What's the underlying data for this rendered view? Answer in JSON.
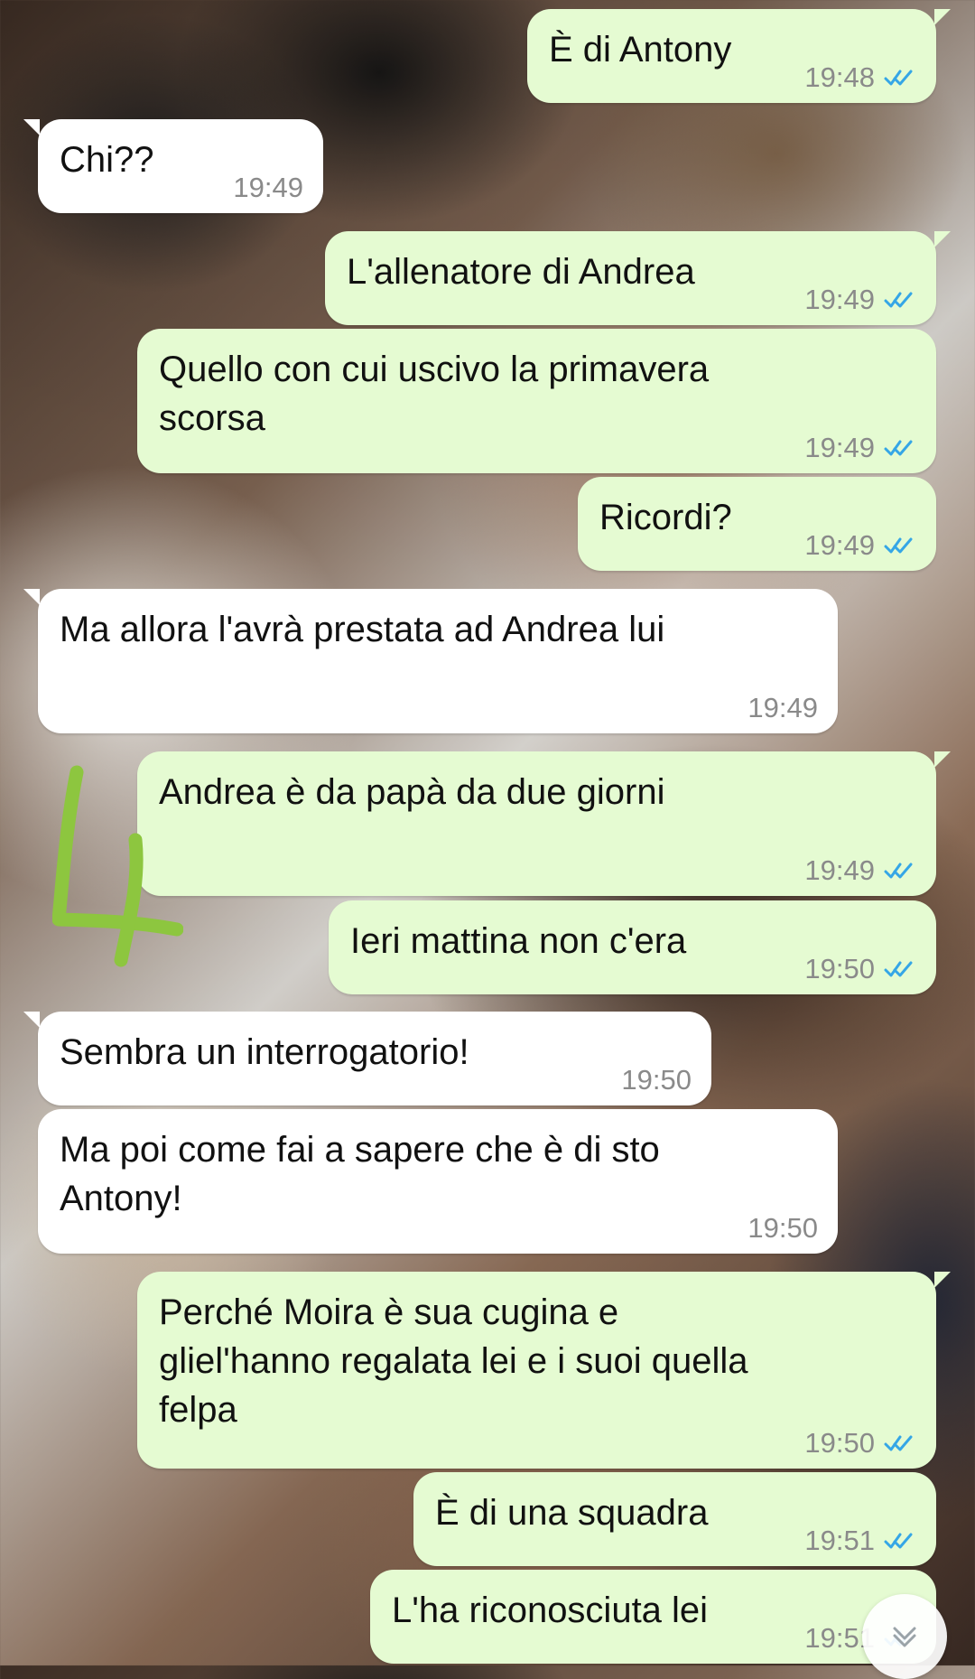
{
  "messages": [
    {
      "direction": "outgoing",
      "text": "È di Antony",
      "time": "19:48",
      "status_icon": "double-check-blue-icon"
    },
    {
      "direction": "incoming",
      "text": "Chi??",
      "time": "19:49",
      "status_icon": ""
    },
    {
      "direction": "outgoing",
      "text": "L'allenatore di Andrea",
      "time": "19:49",
      "status_icon": "double-check-blue-icon"
    },
    {
      "direction": "outgoing",
      "text": "Quello con cui uscivo la primavera\nscorsa",
      "time": "19:49",
      "status_icon": "double-check-blue-icon"
    },
    {
      "direction": "outgoing",
      "text": "Ricordi?",
      "time": "19:49",
      "status_icon": "double-check-blue-icon"
    },
    {
      "direction": "incoming",
      "text": "Ma allora l'avrà prestata ad Andrea lui",
      "time": "19:49",
      "status_icon": ""
    },
    {
      "direction": "outgoing",
      "text": "Andrea è da papà da due giorni",
      "time": "19:49",
      "status_icon": "double-check-blue-icon"
    },
    {
      "direction": "outgoing",
      "text": "Ieri mattina non c'era",
      "time": "19:50",
      "status_icon": "double-check-blue-icon"
    },
    {
      "direction": "incoming",
      "text": "Sembra un interrogatorio!",
      "time": "19:50",
      "status_icon": ""
    },
    {
      "direction": "incoming",
      "text": "Ma poi come fai a sapere che è di sto\nAntony!",
      "time": "19:50",
      "status_icon": ""
    },
    {
      "direction": "outgoing",
      "text": "Perché Moira è sua cugina e\ngliel'hanno regalata lei e i suoi quella\nfelpa",
      "time": "19:50",
      "status_icon": "double-check-blue-icon"
    },
    {
      "direction": "outgoing",
      "text": "È di una squadra",
      "time": "19:51",
      "status_icon": "double-check-blue-icon"
    },
    {
      "direction": "outgoing",
      "text": "L'ha riconosciuta lei",
      "time": "19:51",
      "status_icon": "double-check-blue-icon"
    }
  ],
  "annotation": {
    "text": "4",
    "color": "#8dc63f"
  },
  "controls": {
    "scroll_down_icon": "chevron-down-icon"
  },
  "colors": {
    "outgoing_bubble": "#e5fbd2",
    "incoming_bubble": "#ffffff",
    "read_tick": "#35a6e6",
    "meta_text": "#8a8a8a"
  }
}
